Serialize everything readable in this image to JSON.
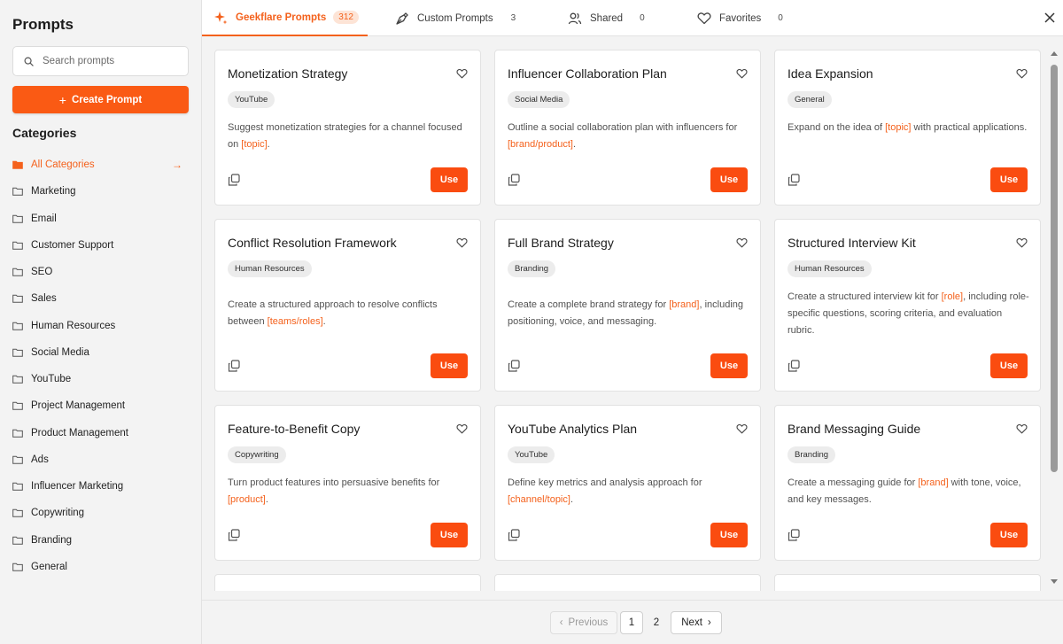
{
  "sidebar": {
    "title": "Prompts",
    "search_placeholder": "Search prompts",
    "create_label": "Create Prompt",
    "categories_title": "Categories",
    "categories": [
      "All Categories",
      "Marketing",
      "Email",
      "Customer Support",
      "SEO",
      "Sales",
      "Human Resources",
      "Social Media",
      "YouTube",
      "Project Management",
      "Product Management",
      "Ads",
      "Influencer Marketing",
      "Copywriting",
      "Branding",
      "General"
    ],
    "active_category": "All Categories"
  },
  "tabs": [
    {
      "label": "Geekflare Prompts",
      "count": "312",
      "icon": "sparkle-icon",
      "active": true
    },
    {
      "label": "Custom Prompts",
      "count": "3",
      "icon": "pen-nib-icon",
      "active": false
    },
    {
      "label": "Shared",
      "count": "0",
      "icon": "users-icon",
      "active": false
    },
    {
      "label": "Favorites",
      "count": "0",
      "icon": "heart-icon",
      "active": false
    }
  ],
  "cards": [
    {
      "title": "Monetization Strategy",
      "tag": "YouTube",
      "desc": [
        {
          "t": "Suggest monetization strategies for a channel focused on "
        },
        {
          "p": "[topic]"
        },
        {
          "t": "."
        }
      ],
      "use_label": "Use"
    },
    {
      "title": "Influencer Collaboration Plan",
      "tag": "Social Media",
      "desc": [
        {
          "t": "Outline a social collaboration plan with influencers for "
        },
        {
          "p": "[brand/product]"
        },
        {
          "t": "."
        }
      ],
      "use_label": "Use"
    },
    {
      "title": "Idea Expansion",
      "tag": "General",
      "desc": [
        {
          "t": "Expand on the idea of "
        },
        {
          "p": "[topic]"
        },
        {
          "t": " with practical applications."
        }
      ],
      "use_label": "Use"
    },
    {
      "title": "Conflict Resolution Framework",
      "tag": "Human Resources",
      "desc": [
        {
          "t": "Create a structured approach to resolve conflicts between "
        },
        {
          "p": "[teams/roles]"
        },
        {
          "t": "."
        }
      ],
      "use_label": "Use"
    },
    {
      "title": "Full Brand Strategy",
      "tag": "Branding",
      "desc": [
        {
          "t": "Create a complete brand strategy for "
        },
        {
          "p": "[brand]"
        },
        {
          "t": ", including positioning, voice, and messaging."
        }
      ],
      "use_label": "Use"
    },
    {
      "title": "Structured Interview Kit",
      "tag": "Human Resources",
      "desc": [
        {
          "t": "Create a structured interview kit for "
        },
        {
          "p": "[role]"
        },
        {
          "t": ", including role-specific questions, scoring criteria, and evaluation rubric."
        }
      ],
      "use_label": "Use"
    },
    {
      "title": "Feature-to-Benefit Copy",
      "tag": "Copywriting",
      "desc": [
        {
          "t": "Turn product features into persuasive benefits for "
        },
        {
          "p": "[product]"
        },
        {
          "t": "."
        }
      ],
      "use_label": "Use"
    },
    {
      "title": "YouTube Analytics Plan",
      "tag": "YouTube",
      "desc": [
        {
          "t": "Define key metrics and analysis approach for "
        },
        {
          "p": "[channel/topic]"
        },
        {
          "t": "."
        }
      ],
      "use_label": "Use"
    },
    {
      "title": "Brand Messaging Guide",
      "tag": "Branding",
      "desc": [
        {
          "t": "Create a messaging guide for "
        },
        {
          "p": "[brand]"
        },
        {
          "t": " with tone, voice, and key messages."
        }
      ],
      "use_label": "Use"
    }
  ],
  "pagination": {
    "prev": "Previous",
    "pages": [
      "1",
      "2"
    ],
    "current": "1",
    "next": "Next"
  },
  "colors": {
    "accent": "#fa5a14",
    "placeholder_text": "#f4611c"
  }
}
